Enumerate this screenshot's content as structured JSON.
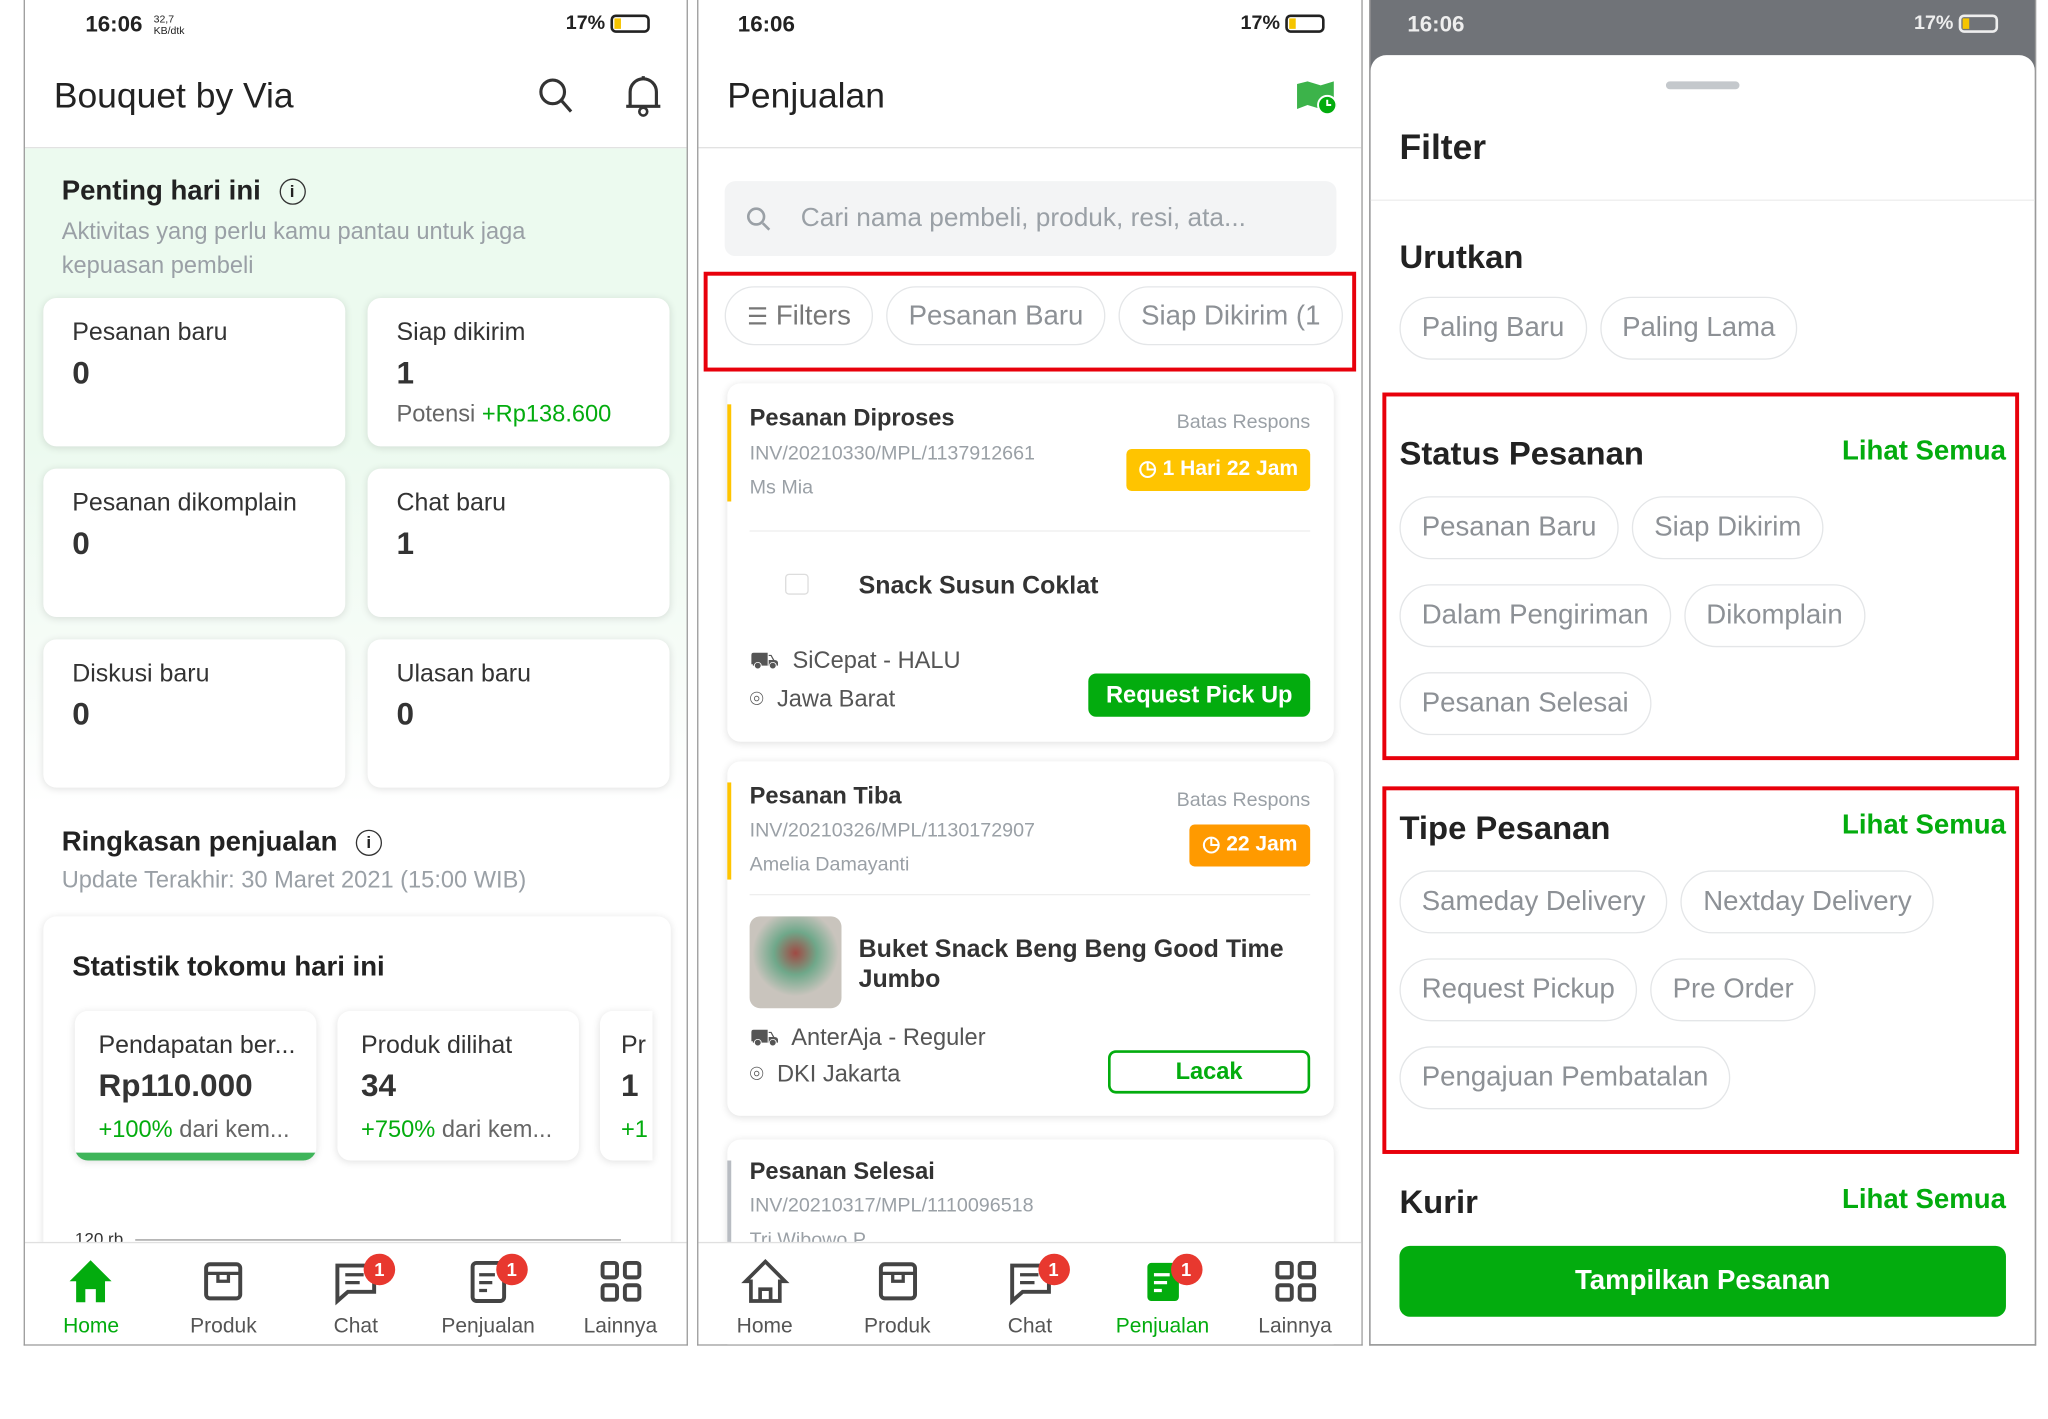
{
  "status_bar": {
    "time": "16:06",
    "speed": "32,7 KB/dtk",
    "battery": "17%"
  },
  "home": {
    "title": "Bouquet by Via",
    "penting": {
      "title": "Penting hari ini",
      "subtitle": "Aktivitas yang perlu kamu pantau untuk jaga kepuasan pembeli",
      "cards": [
        {
          "label": "Pesanan baru",
          "value": "0"
        },
        {
          "label": "Siap dikirim",
          "value": "1",
          "extra_label": "Potensi",
          "extra_value": "+Rp138.600"
        },
        {
          "label": "Pesanan dikomplain",
          "value": "0"
        },
        {
          "label": "Chat baru",
          "value": "1"
        },
        {
          "label": "Diskusi baru",
          "value": "0"
        },
        {
          "label": "Ulasan baru",
          "value": "0"
        }
      ]
    },
    "ringkasan": {
      "title": "Ringkasan penjualan",
      "updated": "Update Terakhir: 30 Maret 2021 (15:00 WIB)"
    },
    "statistik": {
      "title": "Statistik tokomu hari ini",
      "axis_label": "120 rb",
      "cards": [
        {
          "label": "Pendapatan ber...",
          "value": "Rp110.000",
          "change": "+100%",
          "suffix": "dari kem..."
        },
        {
          "label": "Produk dilihat",
          "value": "34",
          "change": "+750%",
          "suffix": "dari kem..."
        },
        {
          "label": "Pr",
          "value": "1",
          "change": "+1",
          "suffix": ""
        }
      ]
    }
  },
  "nav": {
    "items": [
      {
        "label": "Home"
      },
      {
        "label": "Produk"
      },
      {
        "label": "Chat",
        "badge": "1"
      },
      {
        "label": "Penjualan",
        "badge": "1"
      },
      {
        "label": "Lainnya"
      }
    ]
  },
  "penjualan": {
    "title": "Penjualan",
    "search_placeholder": "Cari nama pembeli, produk, resi, ata...",
    "chips": [
      "Filters",
      "Pesanan Baru",
      "Siap Dikirim (1"
    ],
    "orders": [
      {
        "status": "Pesanan Diproses",
        "invoice": "INV/20210330/MPL/1137912661",
        "buyer": "Ms Mia",
        "deadline_label": "Batas Respons",
        "deadline": "1 Hari 22 Jam",
        "deadline_color": "#ffc400",
        "product": "Snack Susun Coklat",
        "courier": "SiCepat - HALU",
        "location": "Jawa Barat",
        "action": "Request Pick Up"
      },
      {
        "status": "Pesanan Tiba",
        "invoice": "INV/20210326/MPL/1130172907",
        "buyer": "Amelia Damayanti",
        "deadline_label": "Batas Respons",
        "deadline": "22 Jam",
        "deadline_color": "#ff9a00",
        "product": "Buket Snack Beng Beng Good Time Jumbo",
        "courier": "AnterAja - Reguler",
        "location": "DKI Jakarta",
        "action": "Lacak"
      },
      {
        "status": "Pesanan Selesai",
        "invoice": "INV/20210317/MPL/1110096518",
        "buyer": "Tri Wibowo P"
      }
    ]
  },
  "filter": {
    "title": "Filter",
    "urutkan": {
      "title": "Urutkan",
      "options": [
        "Paling Baru",
        "Paling Lama"
      ]
    },
    "status": {
      "title": "Status Pesanan",
      "see_all": "Lihat Semua",
      "options": [
        "Pesanan Baru",
        "Siap Dikirim",
        "Dalam Pengiriman",
        "Dikomplain",
        "Pesanan Selesai"
      ]
    },
    "tipe": {
      "title": "Tipe Pesanan",
      "see_all": "Lihat Semua",
      "options": [
        "Sameday Delivery",
        "Nextday Delivery",
        "Request Pickup",
        "Pre Order",
        "Pengajuan Pembatalan"
      ]
    },
    "kurir": {
      "title": "Kurir",
      "see_all": "Lihat Semua"
    },
    "submit": "Tampilkan Pesanan"
  },
  "colors": {
    "brand_green": "#03ac0e",
    "highlight_red": "#e8000b",
    "badge_red": "#e8382f"
  }
}
